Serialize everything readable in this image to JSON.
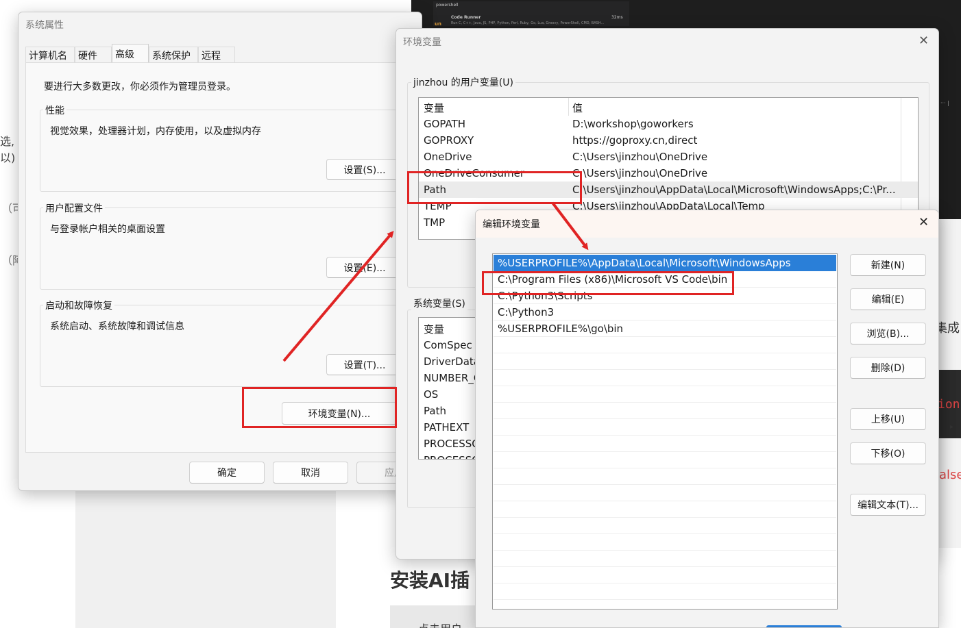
{
  "background": {
    "vscode_tab": {
      "title": "powershell",
      "ext_name": "Code Runner",
      "ext_desc": "Run C, C++, Java, JS, PHP, Python, Perl, Ruby, Go, Lua, Groovy, PowerShell, CMD, BASH...",
      "ext_stat": "32ms",
      "ext_icon_text": "un"
    },
    "left_fragments": [
      "选,",
      "以)",
      "（可",
      "（阿"
    ],
    "right_fragments": [
      "集成",
      "ion",
      "alse"
    ],
    "side_dots": "··· |",
    "chevron": "▸",
    "heading": "安装AI插",
    "bottom_text": "点击用户"
  },
  "system_properties": {
    "title": "系统属性",
    "tabs": [
      "计算机名",
      "硬件",
      "高级",
      "系统保护",
      "远程"
    ],
    "active_tab": 2,
    "admin_note": "要进行大多数更改，你必须作为管理员登录。",
    "groups": [
      {
        "label": "性能",
        "desc": "视觉效果，处理器计划，内存使用，以及虚拟内存",
        "button": "设置(S)..."
      },
      {
        "label": "用户配置文件",
        "desc": "与登录帐户相关的桌面设置",
        "button": "设置(E)..."
      },
      {
        "label": "启动和故障恢复",
        "desc": "系统启动、系统故障和调试信息",
        "button": "设置(T)..."
      }
    ],
    "env_button": "环境变量(N)...",
    "ok": "确定",
    "cancel": "取消",
    "apply": "应用"
  },
  "env_variables": {
    "title": "环境变量",
    "user_group_label": "jinzhou 的用户变量(U)",
    "col_var": "变量",
    "col_val": "值",
    "user_rows": [
      {
        "name": "GOPATH",
        "value": "D:\\workshop\\goworkers"
      },
      {
        "name": "GOPROXY",
        "value": "https://goproxy.cn,direct"
      },
      {
        "name": "OneDrive",
        "value": "C:\\Users\\jinzhou\\OneDrive"
      },
      {
        "name": "OneDriveConsumer",
        "value": "C:\\Users\\jinzhou\\OneDrive"
      },
      {
        "name": "Path",
        "value": "C:\\Users\\jinzhou\\AppData\\Local\\Microsoft\\WindowsApps;C:\\Pr..."
      },
      {
        "name": "TEMP",
        "value": "C:\\Users\\jinzhou\\AppData\\Local\\Temp"
      },
      {
        "name": "TMP",
        "value": ""
      }
    ],
    "user_selected": 4,
    "sys_group_label": "系统变量(S)",
    "sys_rows": [
      {
        "name": "ComSpec"
      },
      {
        "name": "DriverData"
      },
      {
        "name": "NUMBER_O"
      },
      {
        "name": "OS"
      },
      {
        "name": "Path"
      },
      {
        "name": "PATHEXT"
      },
      {
        "name": "PROCESSO"
      },
      {
        "name": "PROCESSO"
      }
    ]
  },
  "edit_env": {
    "title": "编辑环境变量",
    "entries": [
      "%USERPROFILE%\\AppData\\Local\\Microsoft\\WindowsApps",
      "C:\\Program Files (x86)\\Microsoft VS Code\\bin",
      "C:\\Python3\\Scripts",
      "C:\\Python3",
      "%USERPROFILE%\\go\\bin"
    ],
    "selected": 0,
    "buttons": {
      "new": "新建(N)",
      "edit": "编辑(E)",
      "browse": "浏览(B)...",
      "delete": "删除(D)",
      "move_up": "上移(U)",
      "move_down": "下移(O)",
      "edit_text": "编辑文本(T)..."
    }
  },
  "annotation_color": "#e02424"
}
